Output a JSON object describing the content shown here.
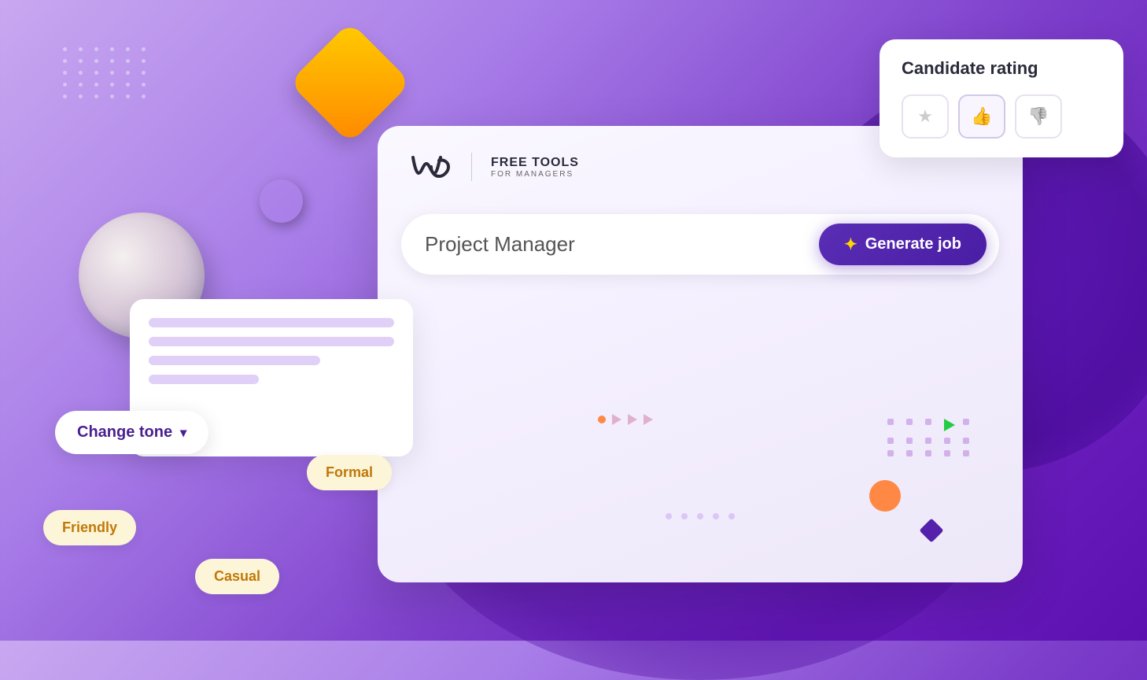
{
  "background": {
    "gradient_start": "#c9a8f0",
    "gradient_end": "#5c10b0"
  },
  "logo": {
    "title": "FREE TOOLS",
    "subtitle": "FOR MANAGERS"
  },
  "job_input": {
    "placeholder": "Project Manager",
    "value": "Project Manager"
  },
  "generate_button": {
    "label": "Generate job",
    "icon": "sparkle-icon"
  },
  "candidate_rating": {
    "title": "Candidate rating",
    "buttons": [
      {
        "icon": "★",
        "label": "star",
        "active": false
      },
      {
        "icon": "👍",
        "label": "thumbs-up",
        "active": true
      },
      {
        "icon": "👎",
        "label": "thumbs-down",
        "active": false
      }
    ]
  },
  "change_tone": {
    "label": "Change tone",
    "icon": "chevron-down"
  },
  "tone_tags": [
    {
      "label": "Formal",
      "class": "tag-formal"
    },
    {
      "label": "Friendly",
      "class": "tag-friendly"
    },
    {
      "label": "Casual",
      "class": "tag-casual"
    }
  ],
  "decorative": {
    "dot_grid_count": 30,
    "ball_color": "radial pearlescent",
    "diamond_color": "orange-yellow gradient"
  }
}
